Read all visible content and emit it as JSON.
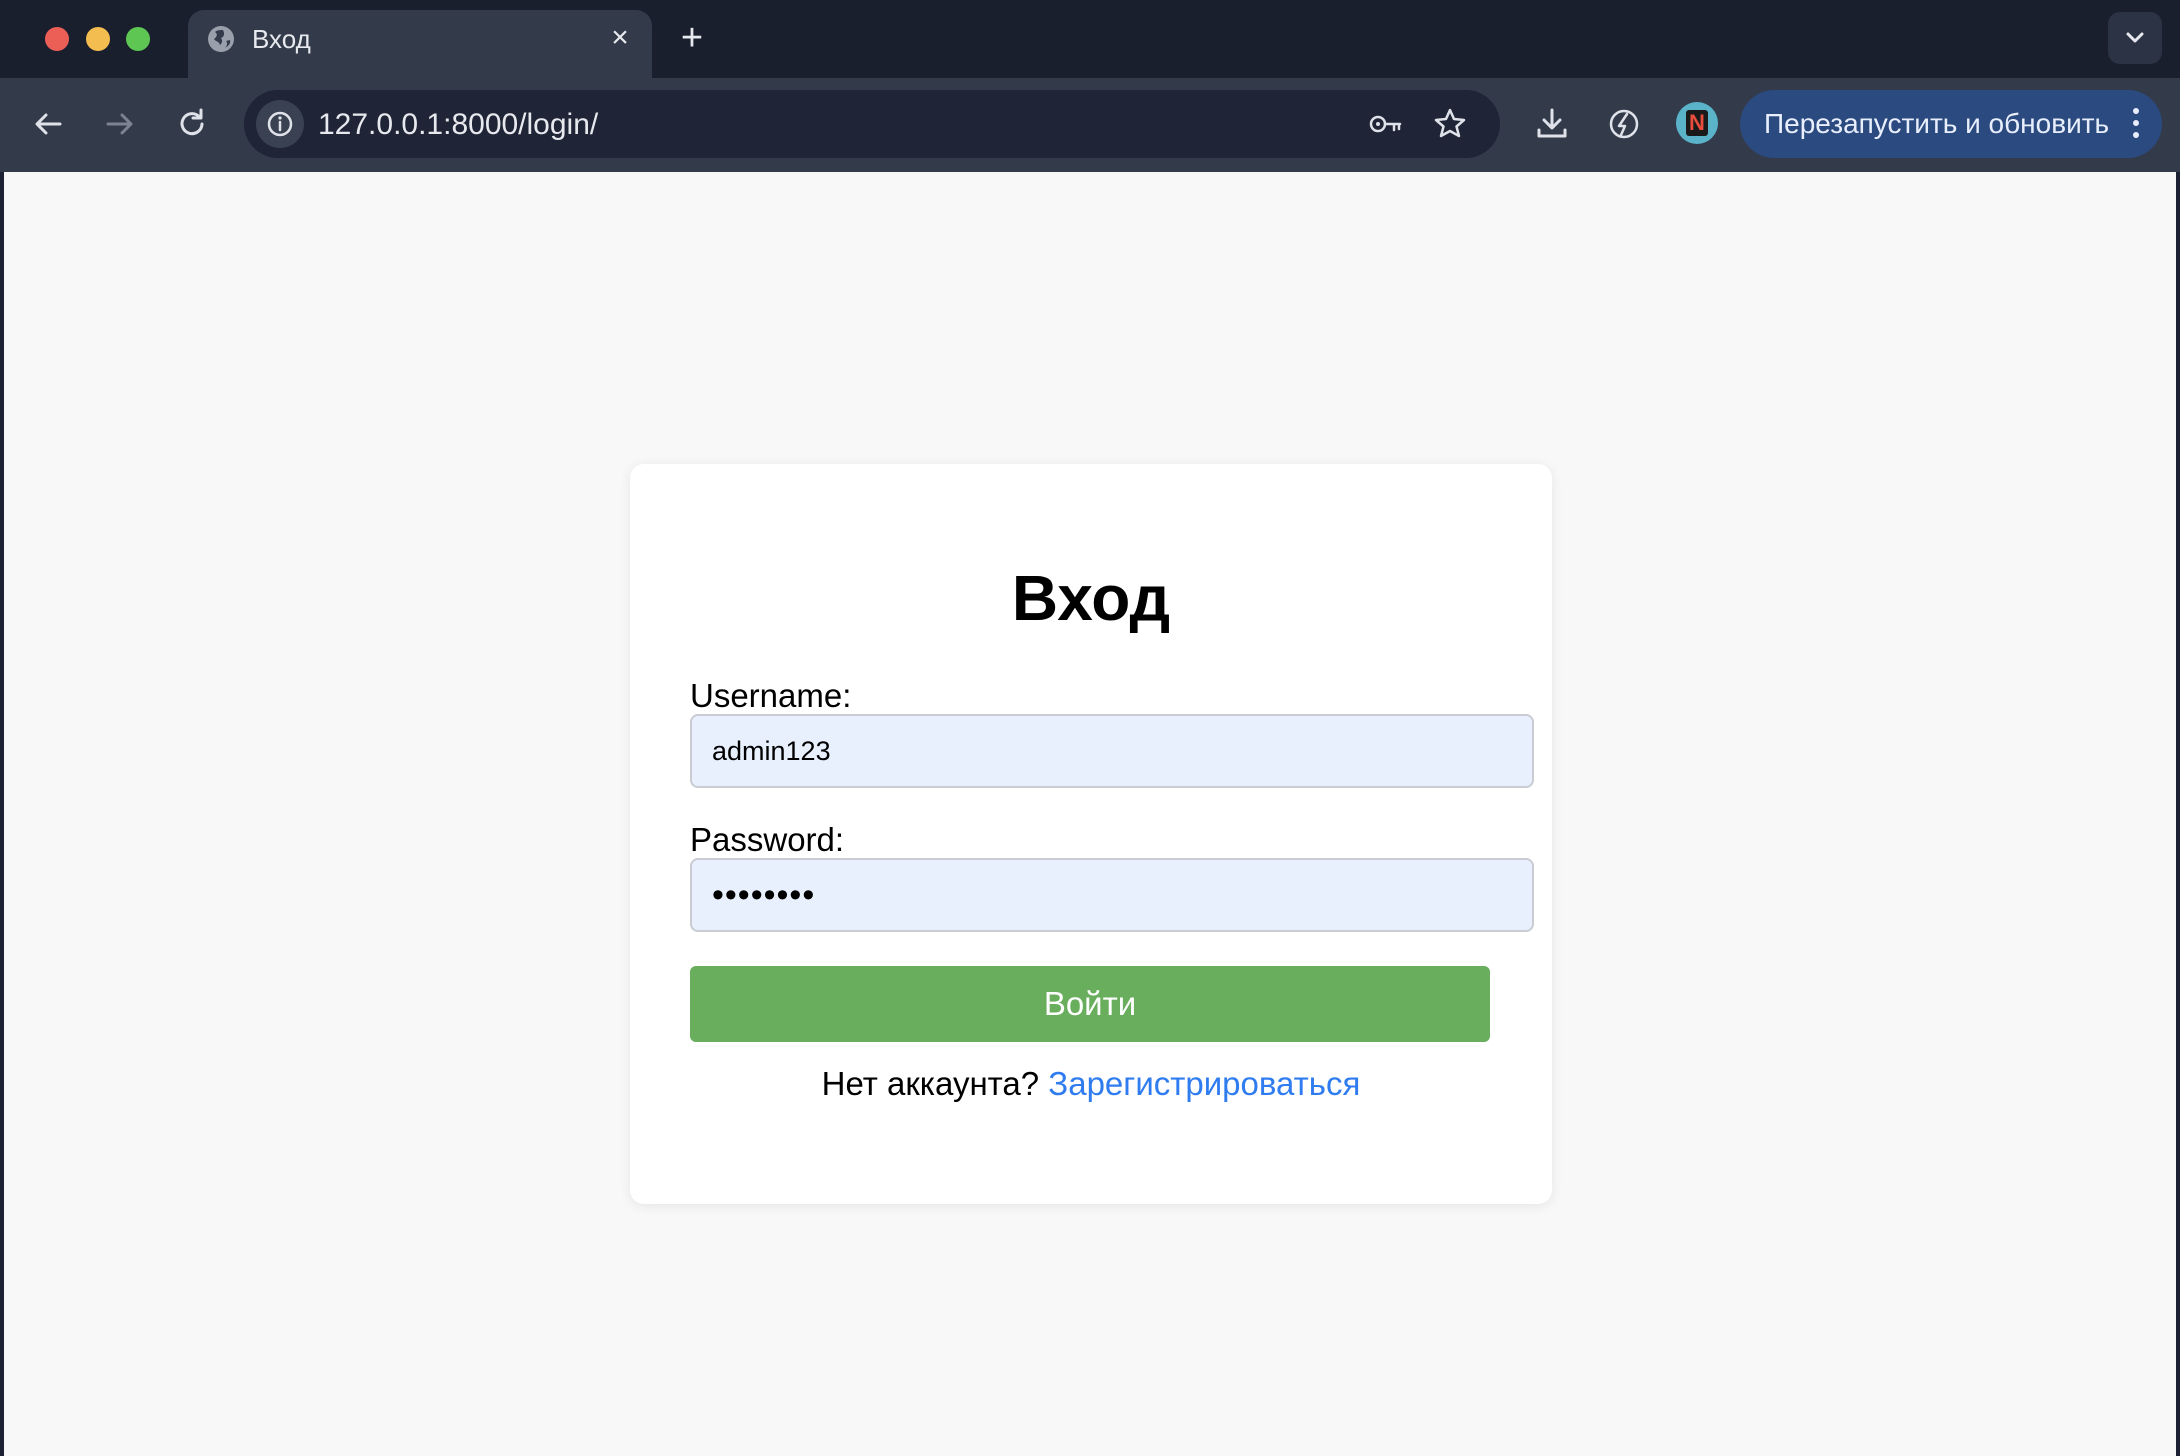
{
  "browser": {
    "tab": {
      "title": "Вход",
      "close_icon": "×"
    },
    "new_tab_icon": "+",
    "address_bar": {
      "url": "127.0.0.1:8000/login/"
    },
    "update_button": {
      "label": "Перезапустить и обновить"
    },
    "profile_avatar_letter": "N",
    "colors": {
      "tabstrip": "#1a1f2d",
      "toolbar": "#333a4a",
      "update_button": "#2b4a7f"
    }
  },
  "login": {
    "title": "Вход",
    "username": {
      "label": "Username:",
      "value": "admin123"
    },
    "password": {
      "label": "Password:",
      "value": "••••••••"
    },
    "submit_label": "Войти",
    "no_account_text": "Нет аккаунта?",
    "register_link": "Зарегистрироваться",
    "colors": {
      "submit": "#68ae5c",
      "link": "#2f7cf0",
      "input_bg": "#e8f0fe",
      "page_bg": "#f8f8f8"
    }
  }
}
